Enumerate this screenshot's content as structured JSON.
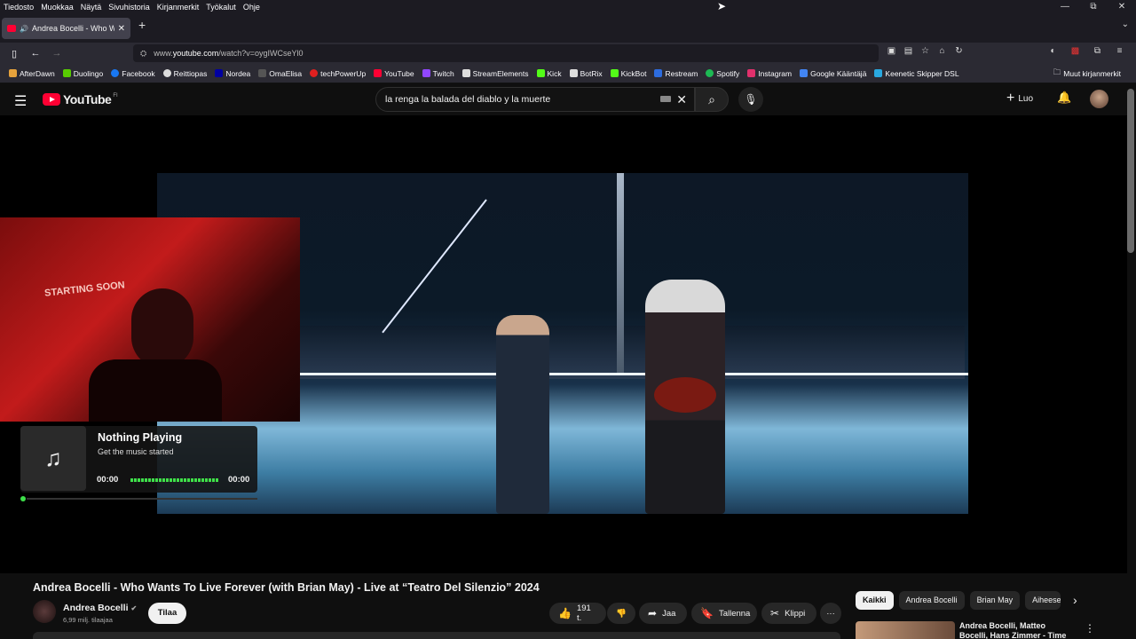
{
  "menubar": [
    "Tiedosto",
    "Muokkaa",
    "Näytä",
    "Sivuhistoria",
    "Kirjanmerkit",
    "Työkalut",
    "Ohje"
  ],
  "window_controls": {
    "minimize": "—",
    "restore": "⧉",
    "close": "✕"
  },
  "tab": {
    "title": "Andrea Bocelli - Who Wants To Live Forever",
    "close": "✕",
    "new_tab": "+",
    "menu": "⌄"
  },
  "nav": {
    "back": "←",
    "forward": "→",
    "sidebar": "▯"
  },
  "url": {
    "prefix": "www.",
    "domain": "youtube.com",
    "path": "/watch?v=oygIWCseYl0"
  },
  "bookmarks": [
    {
      "label": "AfterDawn",
      "color": "#e6a23c"
    },
    {
      "label": "Duolingo",
      "color": "#58cc02"
    },
    {
      "label": "Facebook",
      "color": "#1877f2"
    },
    {
      "label": "Reittiopas",
      "color": "#dddddd"
    },
    {
      "label": "Nordea",
      "color": "#0000a0"
    },
    {
      "label": "OmaElisa",
      "color": "#2b2a33"
    },
    {
      "label": "techPowerUp",
      "color": "#e02020"
    },
    {
      "label": "YouTube",
      "color": "#ff0033"
    },
    {
      "label": "Twitch",
      "color": "#9146ff"
    },
    {
      "label": "StreamElements",
      "color": "#dddddd"
    },
    {
      "label": "Kick",
      "color": "#53fc18"
    },
    {
      "label": "BotRix",
      "color": "#dddddd"
    },
    {
      "label": "KickBot",
      "color": "#53fc18"
    },
    {
      "label": "Restream",
      "color": "#2d6cdf"
    },
    {
      "label": "Spotify",
      "color": "#1db954"
    },
    {
      "label": "Instagram",
      "color": "#e1306c"
    },
    {
      "label": "Google Kääntäjä",
      "color": "#4285f4"
    },
    {
      "label": "Keenetic Skipper DSL",
      "color": "#29a8e0"
    }
  ],
  "bookmarks_other": "Muut kirjanmerkit",
  "youtube": {
    "logo": "YouTube",
    "region": "FI",
    "search_value": "la renga la balada del diablo y la muerte",
    "create_label": "Luo"
  },
  "overlay": {
    "webcam_sign": "STARTING SOON",
    "widget_title": "Nothing Playing",
    "widget_sub": "Get the music started",
    "time_start": "00:00",
    "time_end": "00:00",
    "level": 0
  },
  "video": {
    "title": "Andrea Bocelli - Who Wants To Live Forever (with Brian May) - Live at “Teatro Del Silenzio” 2024",
    "channel": "Andrea Bocelli",
    "subscribers": "6,99 milj. tilaajaa",
    "subscribe": "Tilaa",
    "likes": "191 t.",
    "share": "Jaa",
    "save": "Tallenna",
    "clip": "Klippi",
    "more": "···"
  },
  "chips": [
    "Kaikki",
    "Andrea Bocelli",
    "Brian May",
    "Aiheeseen liittyvät"
  ],
  "recommendation": {
    "title": "Andrea Bocelli, Matteo Bocelli, Hans Zimmer - Time To Say Goodbye"
  }
}
